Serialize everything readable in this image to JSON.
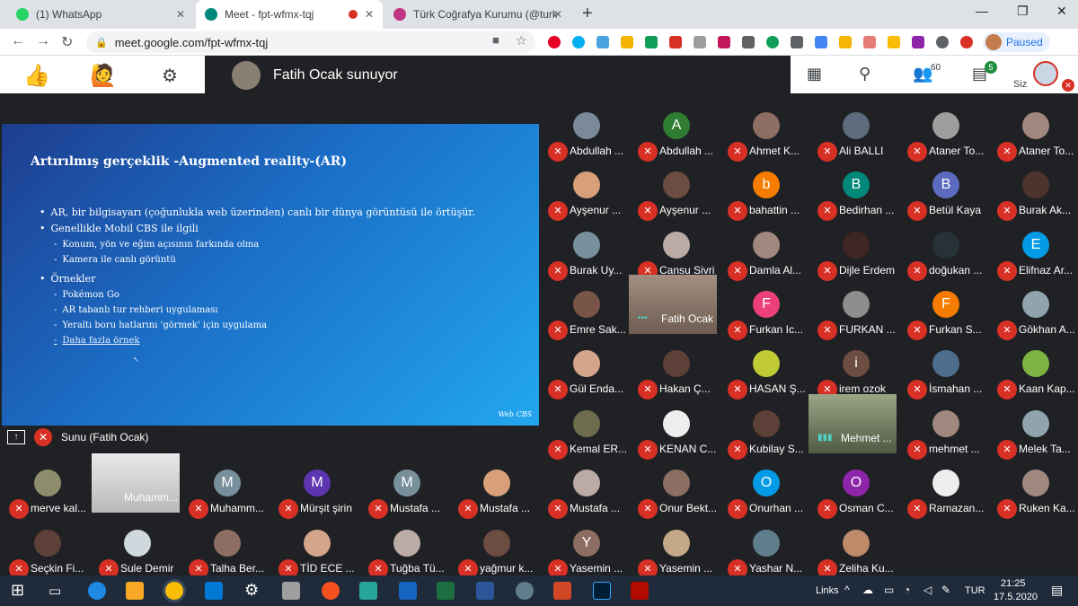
{
  "browser": {
    "tabs": [
      {
        "label": "(1) WhatsApp",
        "color": "#25d366"
      },
      {
        "label": "Meet - fpt-wfmx-tqj",
        "color": "#00897b"
      },
      {
        "label": "Türk Coğrafya Kurumu (@turkcog",
        "color": "#c13584"
      }
    ],
    "url": "meet.google.com/fpt-wfmx-tqj",
    "profile_status": "Paused"
  },
  "meet": {
    "presenter_label": "Fatih Ocak sunuyor",
    "participant_count": "60",
    "chat_badge": "5",
    "self_label": "Siz",
    "presentation_label": "Sunu (Fatih Ocak)"
  },
  "slide": {
    "title": "Artırılmış gerçeklik -Augmented reality-(AR)",
    "b1": "AR, bir bilgisayarı (çoğunlukla web üzerinden) canlı bir dünya görüntüsü ile örtüşür.",
    "b2": "Genellikle Mobil CBS ile ilgili",
    "b2a": "Konum, yön ve eğim açısının farkında olma",
    "b2b": "Kamera ile canlı görüntü",
    "b3": "Örnekler",
    "b3a": "Pokémon Go",
    "b3b": "AR tabanlı tur rehberi uygulaması",
    "b3c": "Yeraltı boru hatlarını 'görmek' için uygulama",
    "b3d": "Daha fazla örnek",
    "footer": "Web CBS"
  },
  "participants": [
    {
      "name": "Abdullah ...",
      "initial": "",
      "color": "#7b8a99"
    },
    {
      "name": "Abdullah ...",
      "initial": "A",
      "color": "#2e7d32"
    },
    {
      "name": "Ahmet K...",
      "initial": "",
      "color": "#8d6e63"
    },
    {
      "name": "Ali BALLI",
      "initial": "",
      "color": "#5d6d7e"
    },
    {
      "name": "Ataner To...",
      "initial": "",
      "color": "#9e9e9e"
    },
    {
      "name": "Ataner To...",
      "initial": "",
      "color": "#a1887f"
    },
    {
      "name": "Ayşenur ...",
      "initial": "",
      "color": "#d7a07a"
    },
    {
      "name": "Ayşenur ...",
      "initial": "",
      "color": "#6d4c41"
    },
    {
      "name": "bahattin ...",
      "initial": "b",
      "color": "#f57c00"
    },
    {
      "name": "Bedirhan ...",
      "initial": "B",
      "color": "#00897b"
    },
    {
      "name": "Betül Kaya",
      "initial": "B",
      "color": "#5c6bc0"
    },
    {
      "name": "Burak Ak...",
      "initial": "",
      "color": "#4e342e"
    },
    {
      "name": "Burak Uy...",
      "initial": "",
      "color": "#78909c"
    },
    {
      "name": "Cansu Sivri",
      "initial": "",
      "color": "#bcaaa4"
    },
    {
      "name": "Damla Al...",
      "initial": "",
      "color": "#a1887f"
    },
    {
      "name": "Dijle Erdem",
      "initial": "",
      "color": "#3e2723"
    },
    {
      "name": "doğukan ...",
      "initial": "",
      "color": "#263238"
    },
    {
      "name": "Elifnaz Ar...",
      "initial": "E",
      "color": "#039be5"
    },
    {
      "name": "Emre Sak...",
      "initial": "",
      "color": "#795548"
    },
    {
      "name": "Furkan Ic...",
      "initial": "F",
      "color": "#ec407a"
    },
    {
      "name": "FURKAN ...",
      "initial": "",
      "color": "#8d8d8d"
    },
    {
      "name": "Furkan S...",
      "initial": "F",
      "color": "#f57c00"
    },
    {
      "name": "Gökhan A...",
      "initial": "",
      "color": "#90a4ae"
    },
    {
      "name": "Gül Enda...",
      "initial": "",
      "color": "#d4a58a"
    },
    {
      "name": "Hakan Ç...",
      "initial": "",
      "color": "#5d4037"
    },
    {
      "name": "HASAN Ş...",
      "initial": "",
      "color": "#c0ca33"
    },
    {
      "name": "irem ozok",
      "initial": "i",
      "color": "#6d4c41"
    },
    {
      "name": "İsmahan ...",
      "initial": "",
      "color": "#4e6e8e"
    },
    {
      "name": "Kaan Kap...",
      "initial": "",
      "color": "#7cb342"
    },
    {
      "name": "Kemal ER...",
      "initial": "",
      "color": "#6d6d4d"
    },
    {
      "name": "KENAN C...",
      "initial": "",
      "color": "#eeeeee"
    },
    {
      "name": "Kubilay S...",
      "initial": "",
      "color": "#5d4037"
    },
    {
      "name": "mehmet ...",
      "initial": "",
      "color": "#a1887f"
    },
    {
      "name": "Melek Ta...",
      "initial": "",
      "color": "#90a4ae"
    },
    {
      "name": "Mustafa ...",
      "initial": "",
      "color": "#bcaaa4"
    },
    {
      "name": "Onur Bekt...",
      "initial": "",
      "color": "#8d6e63"
    },
    {
      "name": "Onurhan ...",
      "initial": "O",
      "color": "#039be5"
    },
    {
      "name": "Osman C...",
      "initial": "O",
      "color": "#8e24aa"
    },
    {
      "name": "Ramazan...",
      "initial": "",
      "color": "#eeeeee"
    },
    {
      "name": "Ruken Ka...",
      "initial": "",
      "color": "#a1887f"
    },
    {
      "name": "Yasemin ...",
      "initial": "Y",
      "color": "#8d6e63"
    },
    {
      "name": "Yasemin ...",
      "initial": "",
      "color": "#c5a888"
    },
    {
      "name": "Yashar N...",
      "initial": "",
      "color": "#607d8b"
    },
    {
      "name": "Zeliha Ku...",
      "initial": "",
      "color": "#bf8a6a"
    },
    {
      "name": "merve kal...",
      "initial": "",
      "color": "#8d8d6d"
    },
    {
      "name": "Muhamm...",
      "initial": "M",
      "color": "#78909c"
    },
    {
      "name": "Mürşit şirin",
      "initial": "M",
      "color": "#5e35b1"
    },
    {
      "name": "Mustafa ...",
      "initial": "M",
      "color": "#78909c"
    },
    {
      "name": "Mustafa ...",
      "initial": "",
      "color": "#d7a07a"
    },
    {
      "name": "Seçkin Fi...",
      "initial": "",
      "color": "#5d4037"
    },
    {
      "name": "Sule Demir",
      "initial": "",
      "color": "#cfd8dc"
    },
    {
      "name": "Talha Ber...",
      "initial": "",
      "color": "#8d6e63"
    },
    {
      "name": "TİD ECE ...",
      "initial": "",
      "color": "#d4a58a"
    },
    {
      "name": "Tuğba Tü...",
      "initial": "",
      "color": "#bcaaa4"
    },
    {
      "name": "yağmur k...",
      "initial": "",
      "color": "#6d4c41"
    }
  ],
  "video_tiles": [
    {
      "name": "Fatih Ocak",
      "color": "#8a7f73"
    },
    {
      "name": "Mehmet ...",
      "color": "#6e7a62"
    },
    {
      "name": "Muhamm...",
      "color": "#d4d4d4"
    }
  ],
  "taskbar": {
    "links_label": "Links",
    "language": "TUR",
    "time": "21:25",
    "date": "17.5.2020"
  }
}
